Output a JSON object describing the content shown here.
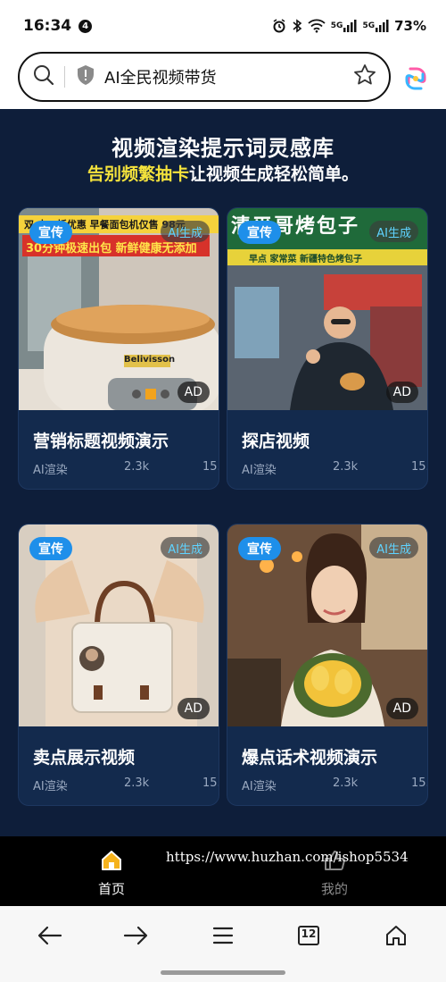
{
  "status_bar": {
    "time": "16:34",
    "notification_count": "4",
    "network_5g_a": "5G",
    "network_5g_b": "5G",
    "battery": "73%"
  },
  "address_bar": {
    "query": "AI全民视频带货"
  },
  "hero": {
    "title": "视频渲染提示词灵感库",
    "subtitle_highlight": "告别频繁抽卡",
    "subtitle_rest": "让视频生成轻松简单。"
  },
  "cards": [
    {
      "title": "营销标题视频演示",
      "promo_tag": "宣传",
      "ai_tag": "AI生成",
      "ad_tag": "AD",
      "source": "AI渲染",
      "stat1": "2.3k",
      "stat2": "15.",
      "banner_line1": "双 十一折优惠 早餐面包机仅售 98元",
      "banner_line2": "30分钟极速出包 新鲜健康无添加",
      "brand": "Belivisson"
    },
    {
      "title": "探店视频",
      "promo_tag": "宣传",
      "ai_tag": "AI生成",
      "ad_tag": "AD",
      "source": "AI渲染",
      "stat1": "2.3k",
      "stat2": "15.",
      "shop_sign": "清平哥烤包子",
      "shop_sub": "早点 家常菜 新疆特色烤包子"
    },
    {
      "title": "卖点展示视频",
      "promo_tag": "宣传",
      "ai_tag": "AI生成",
      "ad_tag": "AD",
      "source": "AI渲染",
      "stat1": "2.3k",
      "stat2": "15."
    },
    {
      "title": "爆点话术视频演示",
      "promo_tag": "宣传",
      "ai_tag": "AI生成",
      "ad_tag": "AD",
      "source": "AI渲染",
      "stat1": "2.3k",
      "stat2": "15."
    }
  ],
  "bottom_nav": {
    "home_label": "首页",
    "mine_label": "我的",
    "watermark": "https://www.huzhan.com/ishop5534"
  },
  "browser_toolbar": {
    "tabs_count": "12"
  },
  "colors": {
    "page_bg": "#0e1e3a",
    "card_bg": "#132a4d",
    "promo_tag": "#1e8fea",
    "ai_tag_text": "#5fd3ff",
    "highlight": "#f4e23c",
    "nav_active": "#ffffff",
    "nav_inactive": "#8a8a8a"
  },
  "icons": {
    "search": "search-icon",
    "shield": "shield-icon",
    "star": "star-icon",
    "home": "home-icon",
    "thumbs_up": "thumbs-up-icon",
    "back": "back-arrow-icon",
    "forward": "forward-arrow-icon",
    "menu": "menu-icon",
    "tabs": "tabs-icon",
    "browser_home": "browser-home-icon"
  }
}
